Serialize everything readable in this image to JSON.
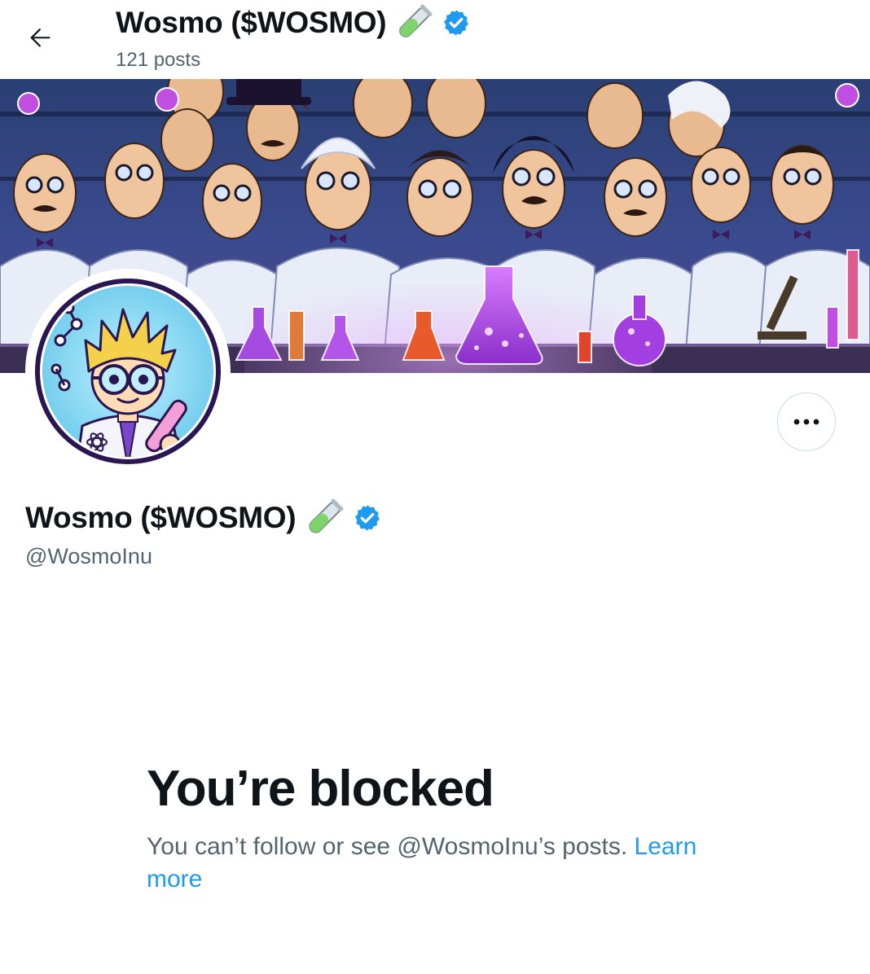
{
  "header": {
    "title": "Wosmo ($WOSMO)",
    "posts_count": "121 posts",
    "back_icon": "arrow-left-icon",
    "title_emoji": "test-tube-icon",
    "verified_icon": "verified-badge-icon"
  },
  "profile": {
    "display_name": "Wosmo ($WOSMO)",
    "handle": "@WosmoInu",
    "more_icon": "more-horizontal-icon",
    "avatar": "scientist-avatar",
    "banner": "mad-scientists-lab-banner"
  },
  "blocked": {
    "title": "You’re blocked",
    "message": "You can’t follow or see @WosmoInu’s posts.",
    "link_label": "Learn more"
  },
  "colors": {
    "verified": "#1d9bf0",
    "link": "#1d9bf0",
    "secondary_text": "#536471",
    "test_tube_liquid": "#7ed36a",
    "banner_purple": "#a63bd9"
  }
}
